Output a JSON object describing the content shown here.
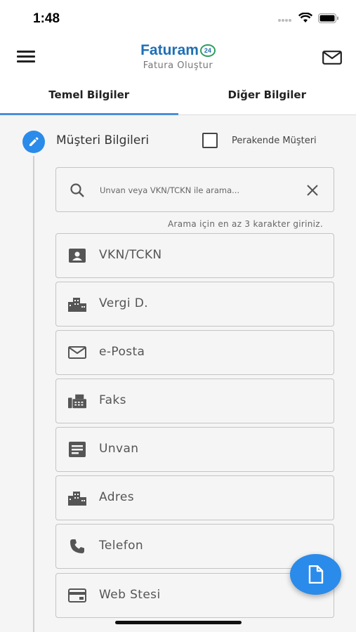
{
  "status": {
    "time": "1:48"
  },
  "header": {
    "logo_text": "Faturam",
    "logo_badge": "24",
    "subtitle": "Fatura Oluştur"
  },
  "tabs": [
    {
      "label": "Temel Bilgiler",
      "active": true
    },
    {
      "label": "Diğer Bilgiler",
      "active": false
    }
  ],
  "customer": {
    "section_title": "Müşteri Bilgileri",
    "retail_label": "Perakende Müşteri",
    "retail_checked": false,
    "search": {
      "placeholder": "Unvan veya VKN/TCKN ile arama...",
      "hint": "Arama için en az 3 karakter giriniz."
    },
    "fields": [
      {
        "label": "VKN/TCKN",
        "icon": "id-card-icon"
      },
      {
        "label": "Vergi D.",
        "icon": "building-icon"
      },
      {
        "label": "e-Posta",
        "icon": "mail-icon"
      },
      {
        "label": "Faks",
        "icon": "fax-icon"
      },
      {
        "label": "Unvan",
        "icon": "title-icon"
      },
      {
        "label": "Adres",
        "icon": "building-icon"
      },
      {
        "label": "Telefon",
        "icon": "phone-icon"
      },
      {
        "label": "Web Stesi",
        "icon": "web-icon"
      }
    ]
  },
  "colors": {
    "accent": "#2a8bea",
    "logo_blue": "#1f6fb5",
    "logo_green": "#2e9e5b"
  }
}
